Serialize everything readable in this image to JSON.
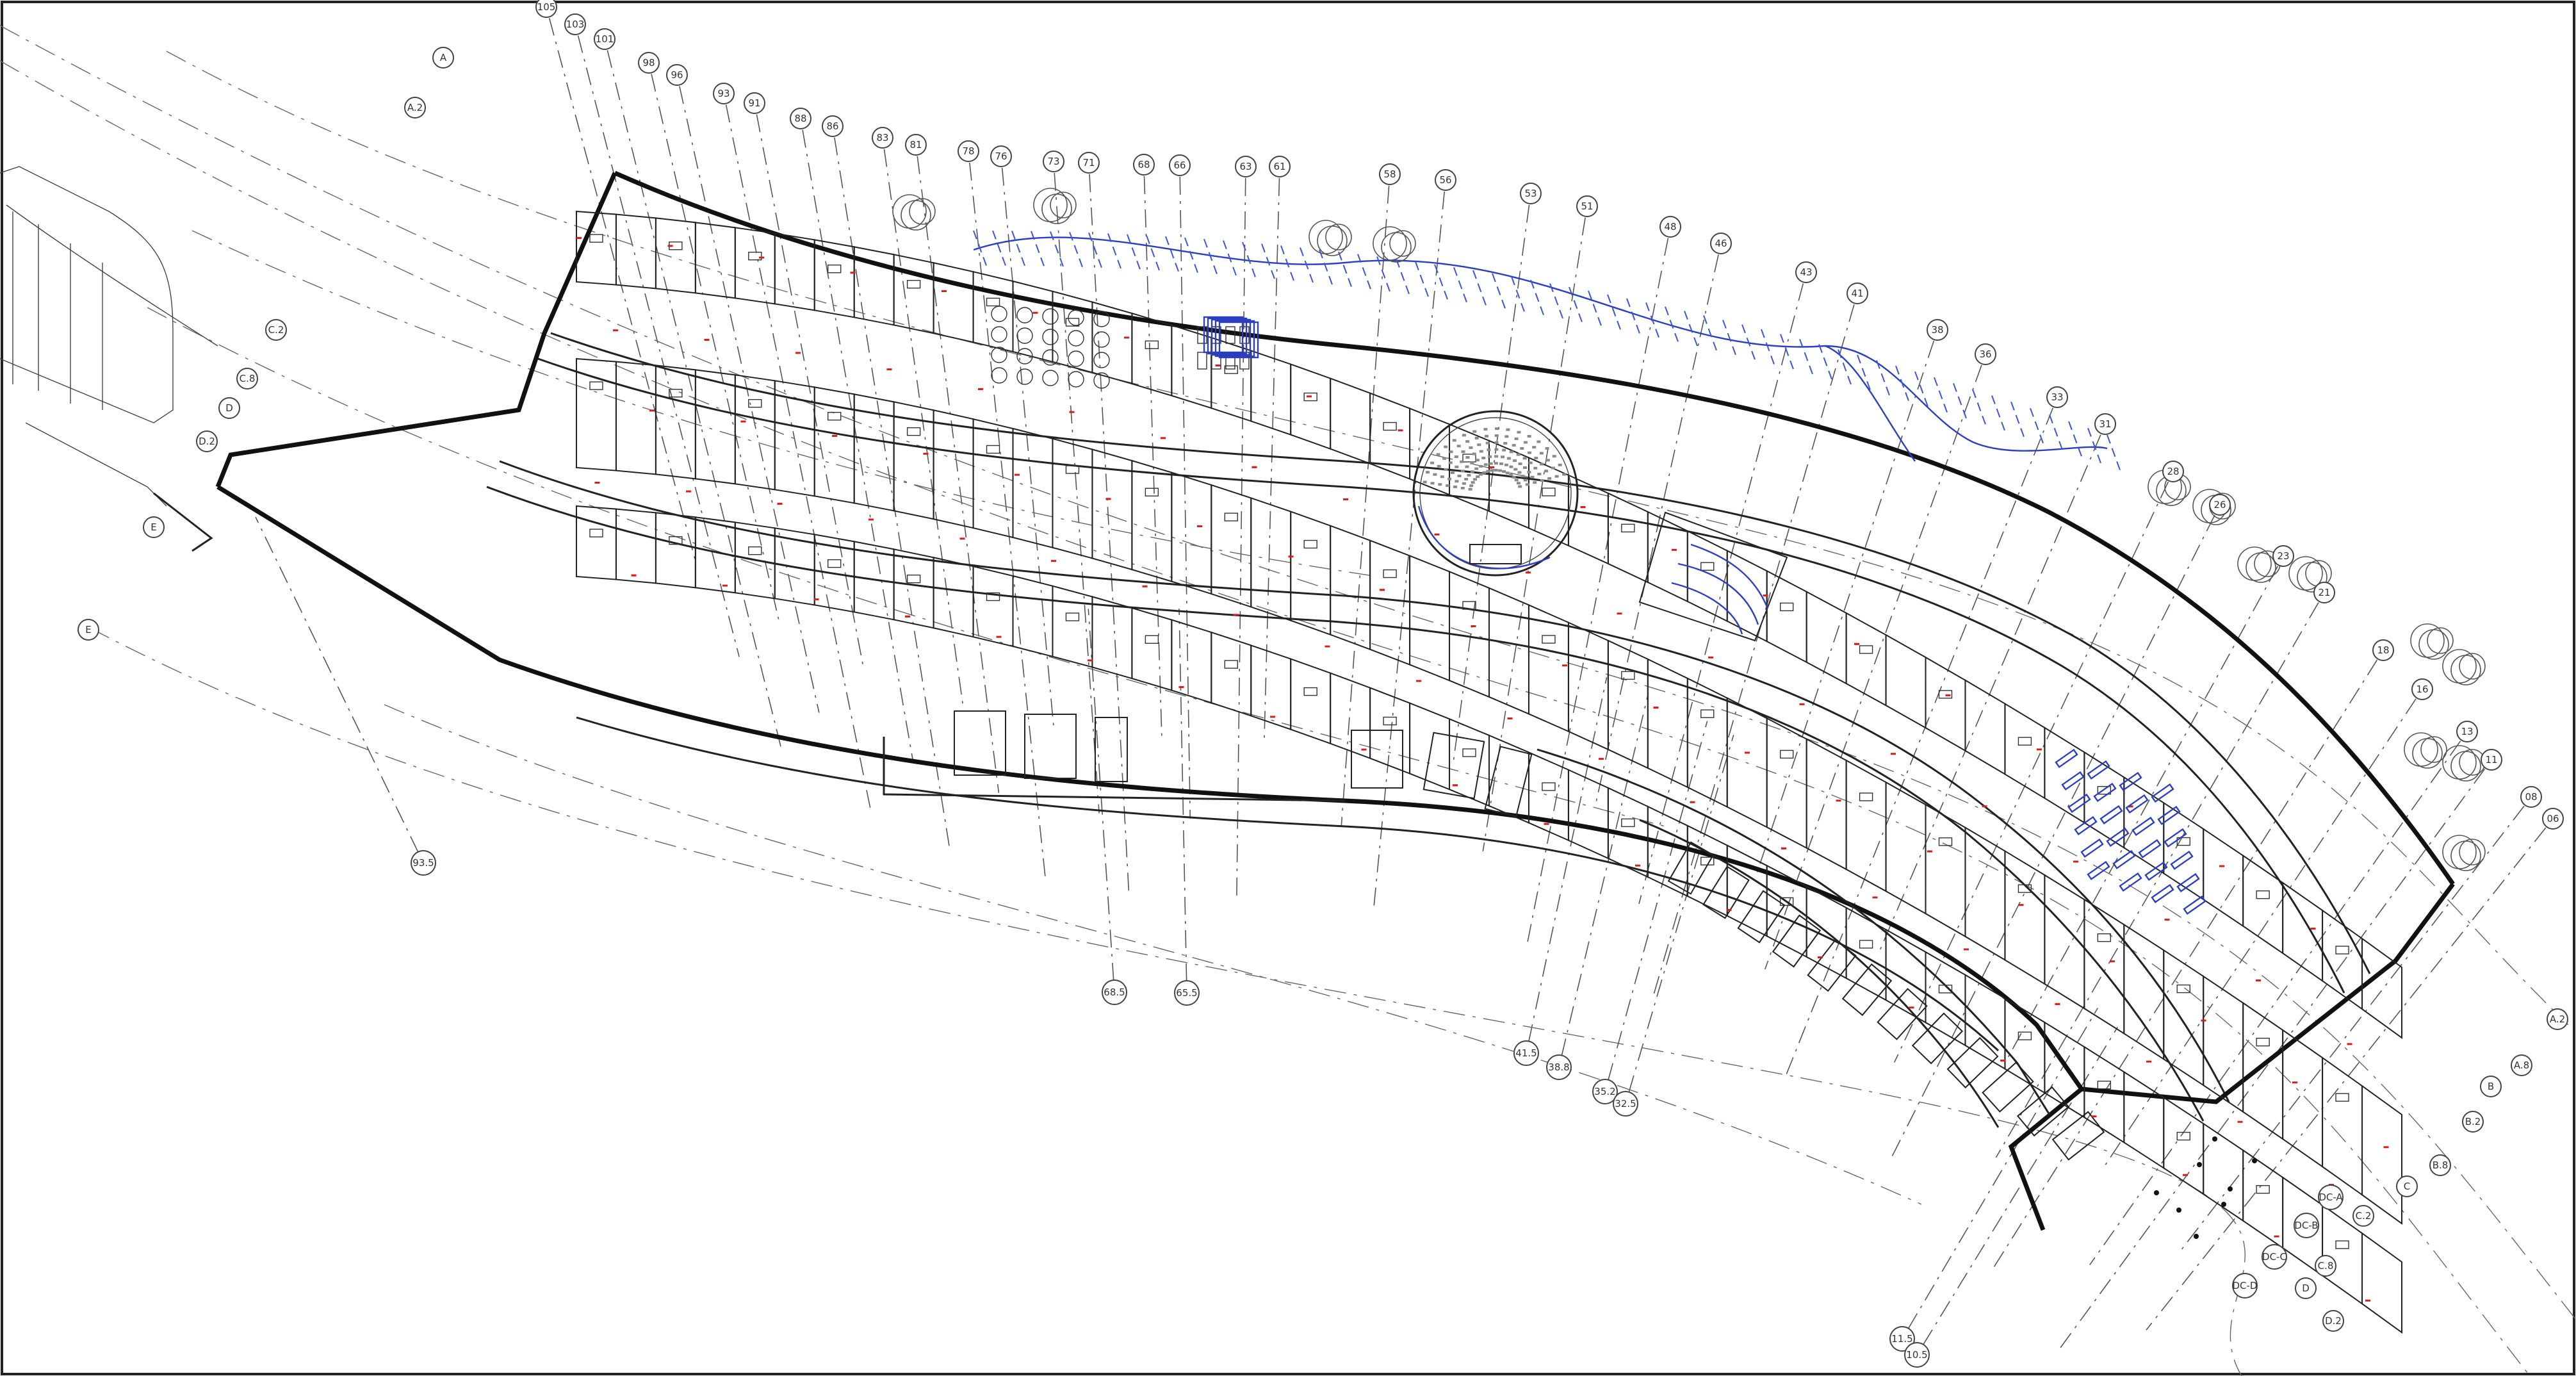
{
  "drawing": {
    "grid_labels_top": [
      "105",
      "103",
      "101",
      "98",
      "96",
      "93",
      "91",
      "88",
      "86",
      "83",
      "81",
      "78",
      "76",
      "73",
      "71",
      "68",
      "66",
      "63",
      "61",
      "58",
      "56",
      "53",
      "51",
      "48",
      "46",
      "43",
      "41",
      "38",
      "36",
      "33",
      "31",
      "28",
      "26",
      "23",
      "21",
      "18",
      "16",
      "13",
      "11",
      "08",
      "06"
    ],
    "grid_labels_bottom": [
      "93.5",
      "68.5",
      "65.5",
      "41.5",
      "38.8",
      "35.2",
      "32.5",
      "11.5",
      "10.5"
    ],
    "grid_labels_lettered": [
      "A",
      "A.2",
      "C.2",
      "C.8",
      "D",
      "D.2",
      "E",
      "E",
      "A.2",
      "A.8",
      "B",
      "B.2",
      "B.8",
      "C",
      "C.2",
      "C.8",
      "D",
      "D.2",
      "DC-A",
      "DC-B",
      "DC-C",
      "DC-D"
    ]
  },
  "colors": {
    "ink": "#111111",
    "blue_markup": "#2b3fbf",
    "red_tags": "#d21f1f",
    "paper": "#ffffff"
  }
}
